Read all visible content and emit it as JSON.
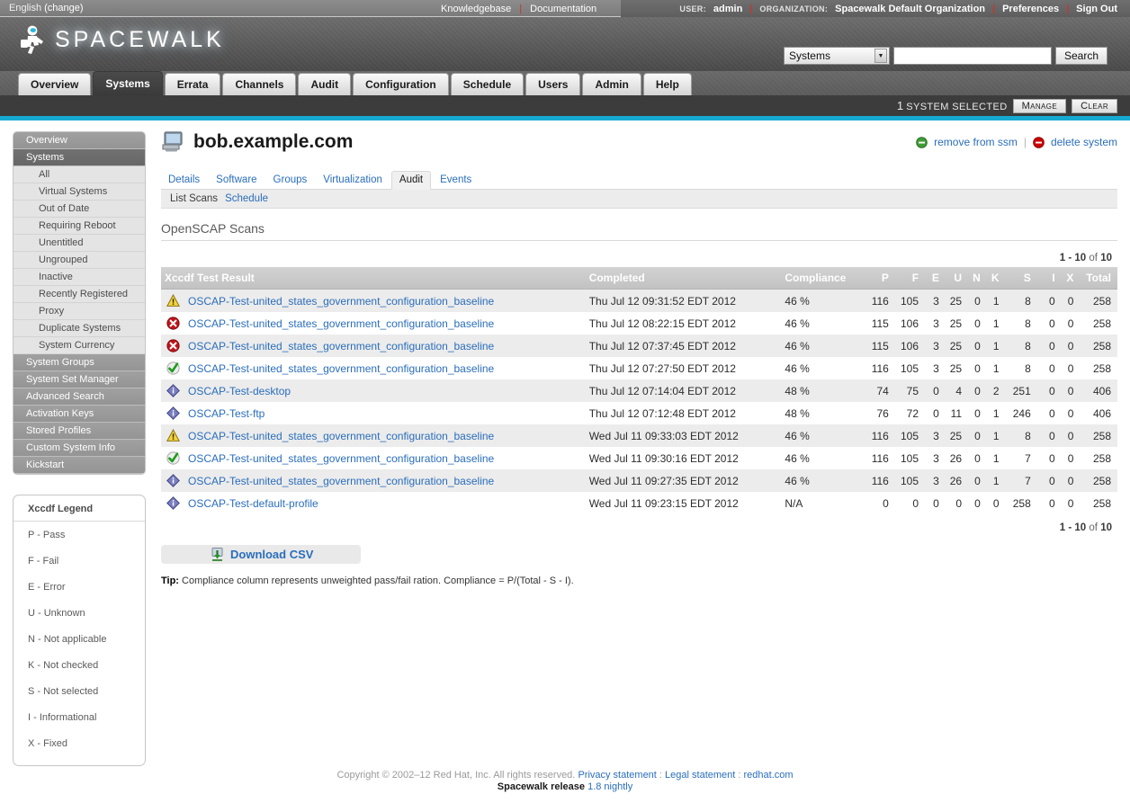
{
  "utility": {
    "language": "English",
    "language_change": "(change)",
    "knowledgebase": "Knowledgebase",
    "documentation": "Documentation",
    "user_label": "USER:",
    "user_name": "admin",
    "org_label": "ORGANIZATION:",
    "org_name": "Spacewalk Default Organization",
    "preferences": "Preferences",
    "sign_out": "Sign Out"
  },
  "brand": {
    "name": "SPACEWALK",
    "accent": "#16aad2"
  },
  "search": {
    "scope_selected": "Systems",
    "query": "",
    "placeholder": "",
    "button": "Search"
  },
  "nav_tabs": [
    {
      "label": "Overview",
      "active": false
    },
    {
      "label": "Systems",
      "active": true
    },
    {
      "label": "Errata",
      "active": false
    },
    {
      "label": "Channels",
      "active": false
    },
    {
      "label": "Audit",
      "active": false
    },
    {
      "label": "Configuration",
      "active": false
    },
    {
      "label": "Schedule",
      "active": false
    },
    {
      "label": "Users",
      "active": false
    },
    {
      "label": "Admin",
      "active": false
    },
    {
      "label": "Help",
      "active": false
    }
  ],
  "ssm": {
    "count": "1",
    "text": "SYSTEM SELECTED",
    "manage": "Manage",
    "clear": "Clear"
  },
  "sidebar": {
    "items": [
      {
        "label": "Overview",
        "level": "top",
        "selected": false
      },
      {
        "label": "Systems",
        "level": "top",
        "selected": true
      },
      {
        "label": "All",
        "level": "sub",
        "selected": false
      },
      {
        "label": "Virtual Systems",
        "level": "sub",
        "selected": false
      },
      {
        "label": "Out of Date",
        "level": "sub",
        "selected": false
      },
      {
        "label": "Requiring Reboot",
        "level": "sub",
        "selected": false
      },
      {
        "label": "Unentitled",
        "level": "sub",
        "selected": false
      },
      {
        "label": "Ungrouped",
        "level": "sub",
        "selected": false
      },
      {
        "label": "Inactive",
        "level": "sub",
        "selected": false
      },
      {
        "label": "Recently Registered",
        "level": "sub",
        "selected": false
      },
      {
        "label": "Proxy",
        "level": "sub",
        "selected": false
      },
      {
        "label": "Duplicate Systems",
        "level": "sub",
        "selected": false
      },
      {
        "label": "System Currency",
        "level": "sub",
        "selected": false
      },
      {
        "label": "System Groups",
        "level": "top",
        "selected": false
      },
      {
        "label": "System Set Manager",
        "level": "top",
        "selected": false
      },
      {
        "label": "Advanced Search",
        "level": "top",
        "selected": false
      },
      {
        "label": "Activation Keys",
        "level": "top",
        "selected": false
      },
      {
        "label": "Stored Profiles",
        "level": "top",
        "selected": false
      },
      {
        "label": "Custom System Info",
        "level": "top",
        "selected": false
      },
      {
        "label": "Kickstart",
        "level": "top",
        "selected": false
      }
    ]
  },
  "legend": {
    "title": "Xccdf Legend",
    "rows": [
      "P - Pass",
      "F - Fail",
      "E - Error",
      "U - Unknown",
      "N - Not applicable",
      "K - Not checked",
      "S - Not selected",
      "I - Informational",
      "X - Fixed"
    ]
  },
  "system": {
    "title": "bob.example.com",
    "icon": "monitor-icon",
    "actions": [
      {
        "label": "remove from ssm",
        "icon": "minus-circle-green-icon"
      },
      {
        "label": "delete system",
        "icon": "minus-circle-red-icon"
      }
    ]
  },
  "subtabs": [
    {
      "label": "Details",
      "active": false
    },
    {
      "label": "Software",
      "active": false
    },
    {
      "label": "Groups",
      "active": false
    },
    {
      "label": "Virtualization",
      "active": false
    },
    {
      "label": "Audit",
      "active": true
    },
    {
      "label": "Events",
      "active": false
    }
  ],
  "subtabs2": [
    {
      "label": "List Scans",
      "active": true
    },
    {
      "label": "Schedule",
      "active": false
    }
  ],
  "section": {
    "title": "OpenSCAP Scans"
  },
  "pager": {
    "range": "1 - 10",
    "of": "of",
    "total": "10"
  },
  "table": {
    "columns": [
      "Xccdf Test Result",
      "Completed",
      "Compliance",
      "P",
      "F",
      "E",
      "U",
      "N",
      "K",
      "S",
      "I",
      "X",
      "Total"
    ],
    "rows": [
      {
        "icon": "warning-icon",
        "name": "OSCAP-Test-united_states_government_configuration_baseline",
        "completed": "Thu Jul 12 09:31:52 EDT 2012",
        "compliance": "46 %",
        "p": "116",
        "f": "105",
        "e": "3",
        "u": "25",
        "n": "0",
        "k": "1",
        "s": "8",
        "i": "0",
        "x": "0",
        "total": "258"
      },
      {
        "icon": "error-icon",
        "name": "OSCAP-Test-united_states_government_configuration_baseline",
        "completed": "Thu Jul 12 08:22:15 EDT 2012",
        "compliance": "46 %",
        "p": "115",
        "f": "106",
        "e": "3",
        "u": "25",
        "n": "0",
        "k": "1",
        "s": "8",
        "i": "0",
        "x": "0",
        "total": "258"
      },
      {
        "icon": "error-icon",
        "name": "OSCAP-Test-united_states_government_configuration_baseline",
        "completed": "Thu Jul 12 07:37:45 EDT 2012",
        "compliance": "46 %",
        "p": "115",
        "f": "106",
        "e": "3",
        "u": "25",
        "n": "0",
        "k": "1",
        "s": "8",
        "i": "0",
        "x": "0",
        "total": "258"
      },
      {
        "icon": "success-icon",
        "name": "OSCAP-Test-united_states_government_configuration_baseline",
        "completed": "Thu Jul 12 07:27:50 EDT 2012",
        "compliance": "46 %",
        "p": "116",
        "f": "105",
        "e": "3",
        "u": "25",
        "n": "0",
        "k": "1",
        "s": "8",
        "i": "0",
        "x": "0",
        "total": "258"
      },
      {
        "icon": "info-icon",
        "name": "OSCAP-Test-desktop",
        "completed": "Thu Jul 12 07:14:04 EDT 2012",
        "compliance": "48 %",
        "p": "74",
        "f": "75",
        "e": "0",
        "u": "4",
        "n": "0",
        "k": "2",
        "s": "251",
        "i": "0",
        "x": "0",
        "total": "406"
      },
      {
        "icon": "info-icon",
        "name": "OSCAP-Test-ftp",
        "completed": "Thu Jul 12 07:12:48 EDT 2012",
        "compliance": "48 %",
        "p": "76",
        "f": "72",
        "e": "0",
        "u": "11",
        "n": "0",
        "k": "1",
        "s": "246",
        "i": "0",
        "x": "0",
        "total": "406"
      },
      {
        "icon": "warning-icon",
        "name": "OSCAP-Test-united_states_government_configuration_baseline",
        "completed": "Wed Jul 11 09:33:03 EDT 2012",
        "compliance": "46 %",
        "p": "116",
        "f": "105",
        "e": "3",
        "u": "25",
        "n": "0",
        "k": "1",
        "s": "8",
        "i": "0",
        "x": "0",
        "total": "258"
      },
      {
        "icon": "success-icon",
        "name": "OSCAP-Test-united_states_government_configuration_baseline",
        "completed": "Wed Jul 11 09:30:16 EDT 2012",
        "compliance": "46 %",
        "p": "116",
        "f": "105",
        "e": "3",
        "u": "26",
        "n": "0",
        "k": "1",
        "s": "7",
        "i": "0",
        "x": "0",
        "total": "258"
      },
      {
        "icon": "info-icon",
        "name": "OSCAP-Test-united_states_government_configuration_baseline",
        "completed": "Wed Jul 11 09:27:35 EDT 2012",
        "compliance": "46 %",
        "p": "116",
        "f": "105",
        "e": "3",
        "u": "26",
        "n": "0",
        "k": "1",
        "s": "7",
        "i": "0",
        "x": "0",
        "total": "258"
      },
      {
        "icon": "info-icon",
        "name": "OSCAP-Test-default-profile",
        "completed": "Wed Jul 11 09:23:15 EDT 2012",
        "compliance": "N/A",
        "p": "0",
        "f": "0",
        "e": "0",
        "u": "0",
        "n": "0",
        "k": "0",
        "s": "258",
        "i": "0",
        "x": "0",
        "total": "258"
      }
    ]
  },
  "download": {
    "label": "Download CSV",
    "icon": "download-icon"
  },
  "tip": {
    "label": "Tip:",
    "text": "Compliance column represents unweighted pass/fail ration. Compliance = P/(Total - S - I)."
  },
  "footer": {
    "copyright": "Copyright © 2002–12 Red Hat, Inc. All rights reserved.",
    "privacy": "Privacy statement",
    "legal": "Legal statement",
    "redhat": "redhat.com",
    "release_label": "Spacewalk release",
    "release_version": "1.8 nightly"
  }
}
